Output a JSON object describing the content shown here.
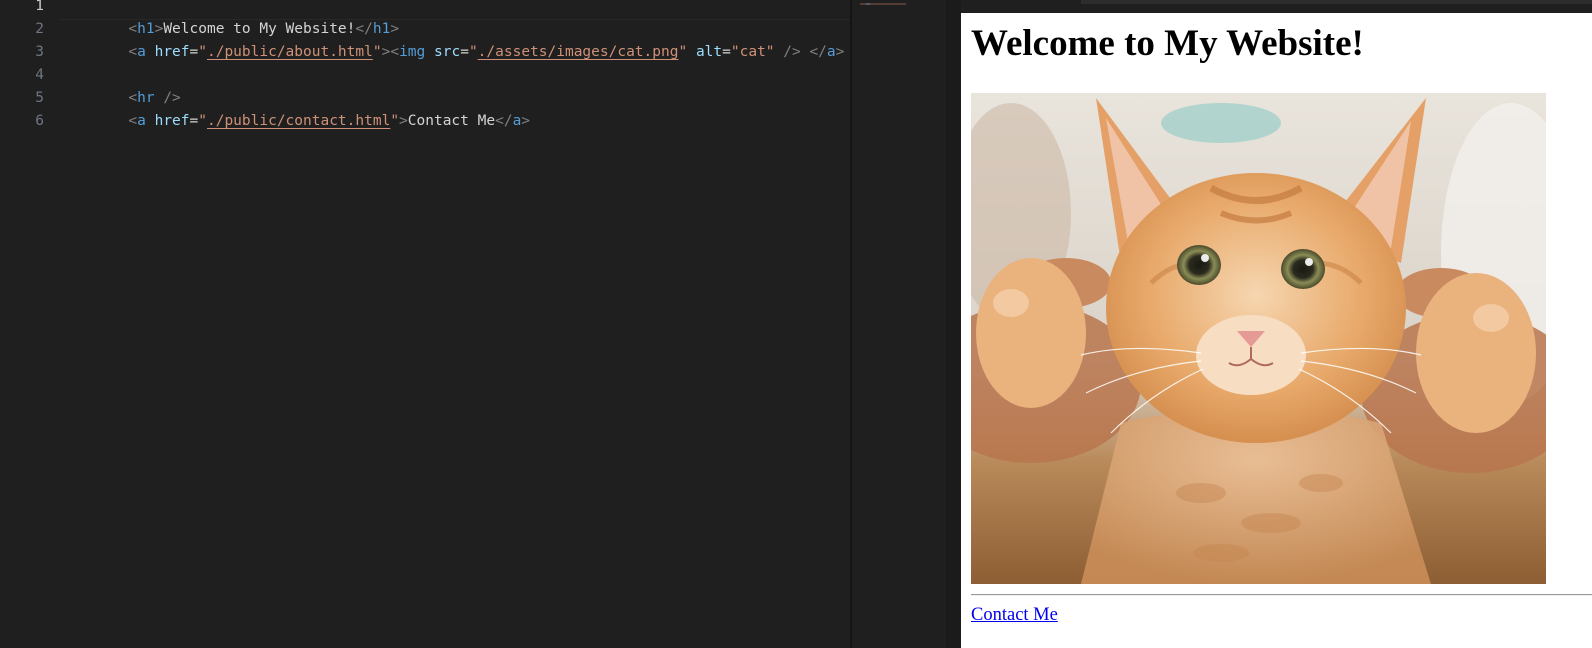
{
  "editor": {
    "line_numbers": [
      "1",
      "2",
      "3",
      "4",
      "5",
      "6"
    ],
    "active_line": "1",
    "lines": {
      "l1": {
        "open": "<",
        "tag": "h1",
        "close": ">",
        "text": "Welcome to My Website!",
        "end_open": "</",
        "end_tag": "h1",
        "end_close": ">"
      },
      "l2": {
        "open": "<",
        "tag": "a",
        "sp": " ",
        "attr1": "href",
        "eq1": "=",
        "q1a": "\"",
        "href": "./public/about.html",
        "q1b": "\"",
        "close": ">",
        "img_open": "<",
        "img_tag": "img",
        "sp2": " ",
        "attr2": "src",
        "eq2": "=",
        "q2a": "\"",
        "src": "./assets/images/cat.png",
        "q2b": "\"",
        "sp3": " ",
        "attr3": "alt",
        "eq3": "=",
        "alt": "\"cat\"",
        "self_close": " /> ",
        "end_open": "</",
        "end_tag": "a",
        "end_close": ">"
      },
      "l4": {
        "open": "<",
        "tag": "hr",
        "self_close": " />"
      },
      "l5": {
        "open": "<",
        "tag": "a",
        "sp": " ",
        "attr1": "href",
        "eq1": "=",
        "q1a": "\"",
        "href": "./public/contact.html",
        "q1b": "\"",
        "close": ">",
        "text": "Contact Me",
        "end_open": "</",
        "end_tag": "a",
        "end_close": ">"
      }
    }
  },
  "preview": {
    "heading": "Welcome to My Website!",
    "image_alt": "cat",
    "link_text": "Contact Me"
  },
  "colors": {
    "editor_bg": "#1f1f1f",
    "tag": "#569cd6",
    "attribute": "#9cdcfe",
    "string": "#ce9178",
    "text": "#d4d4d4",
    "link": "#0000ee"
  }
}
